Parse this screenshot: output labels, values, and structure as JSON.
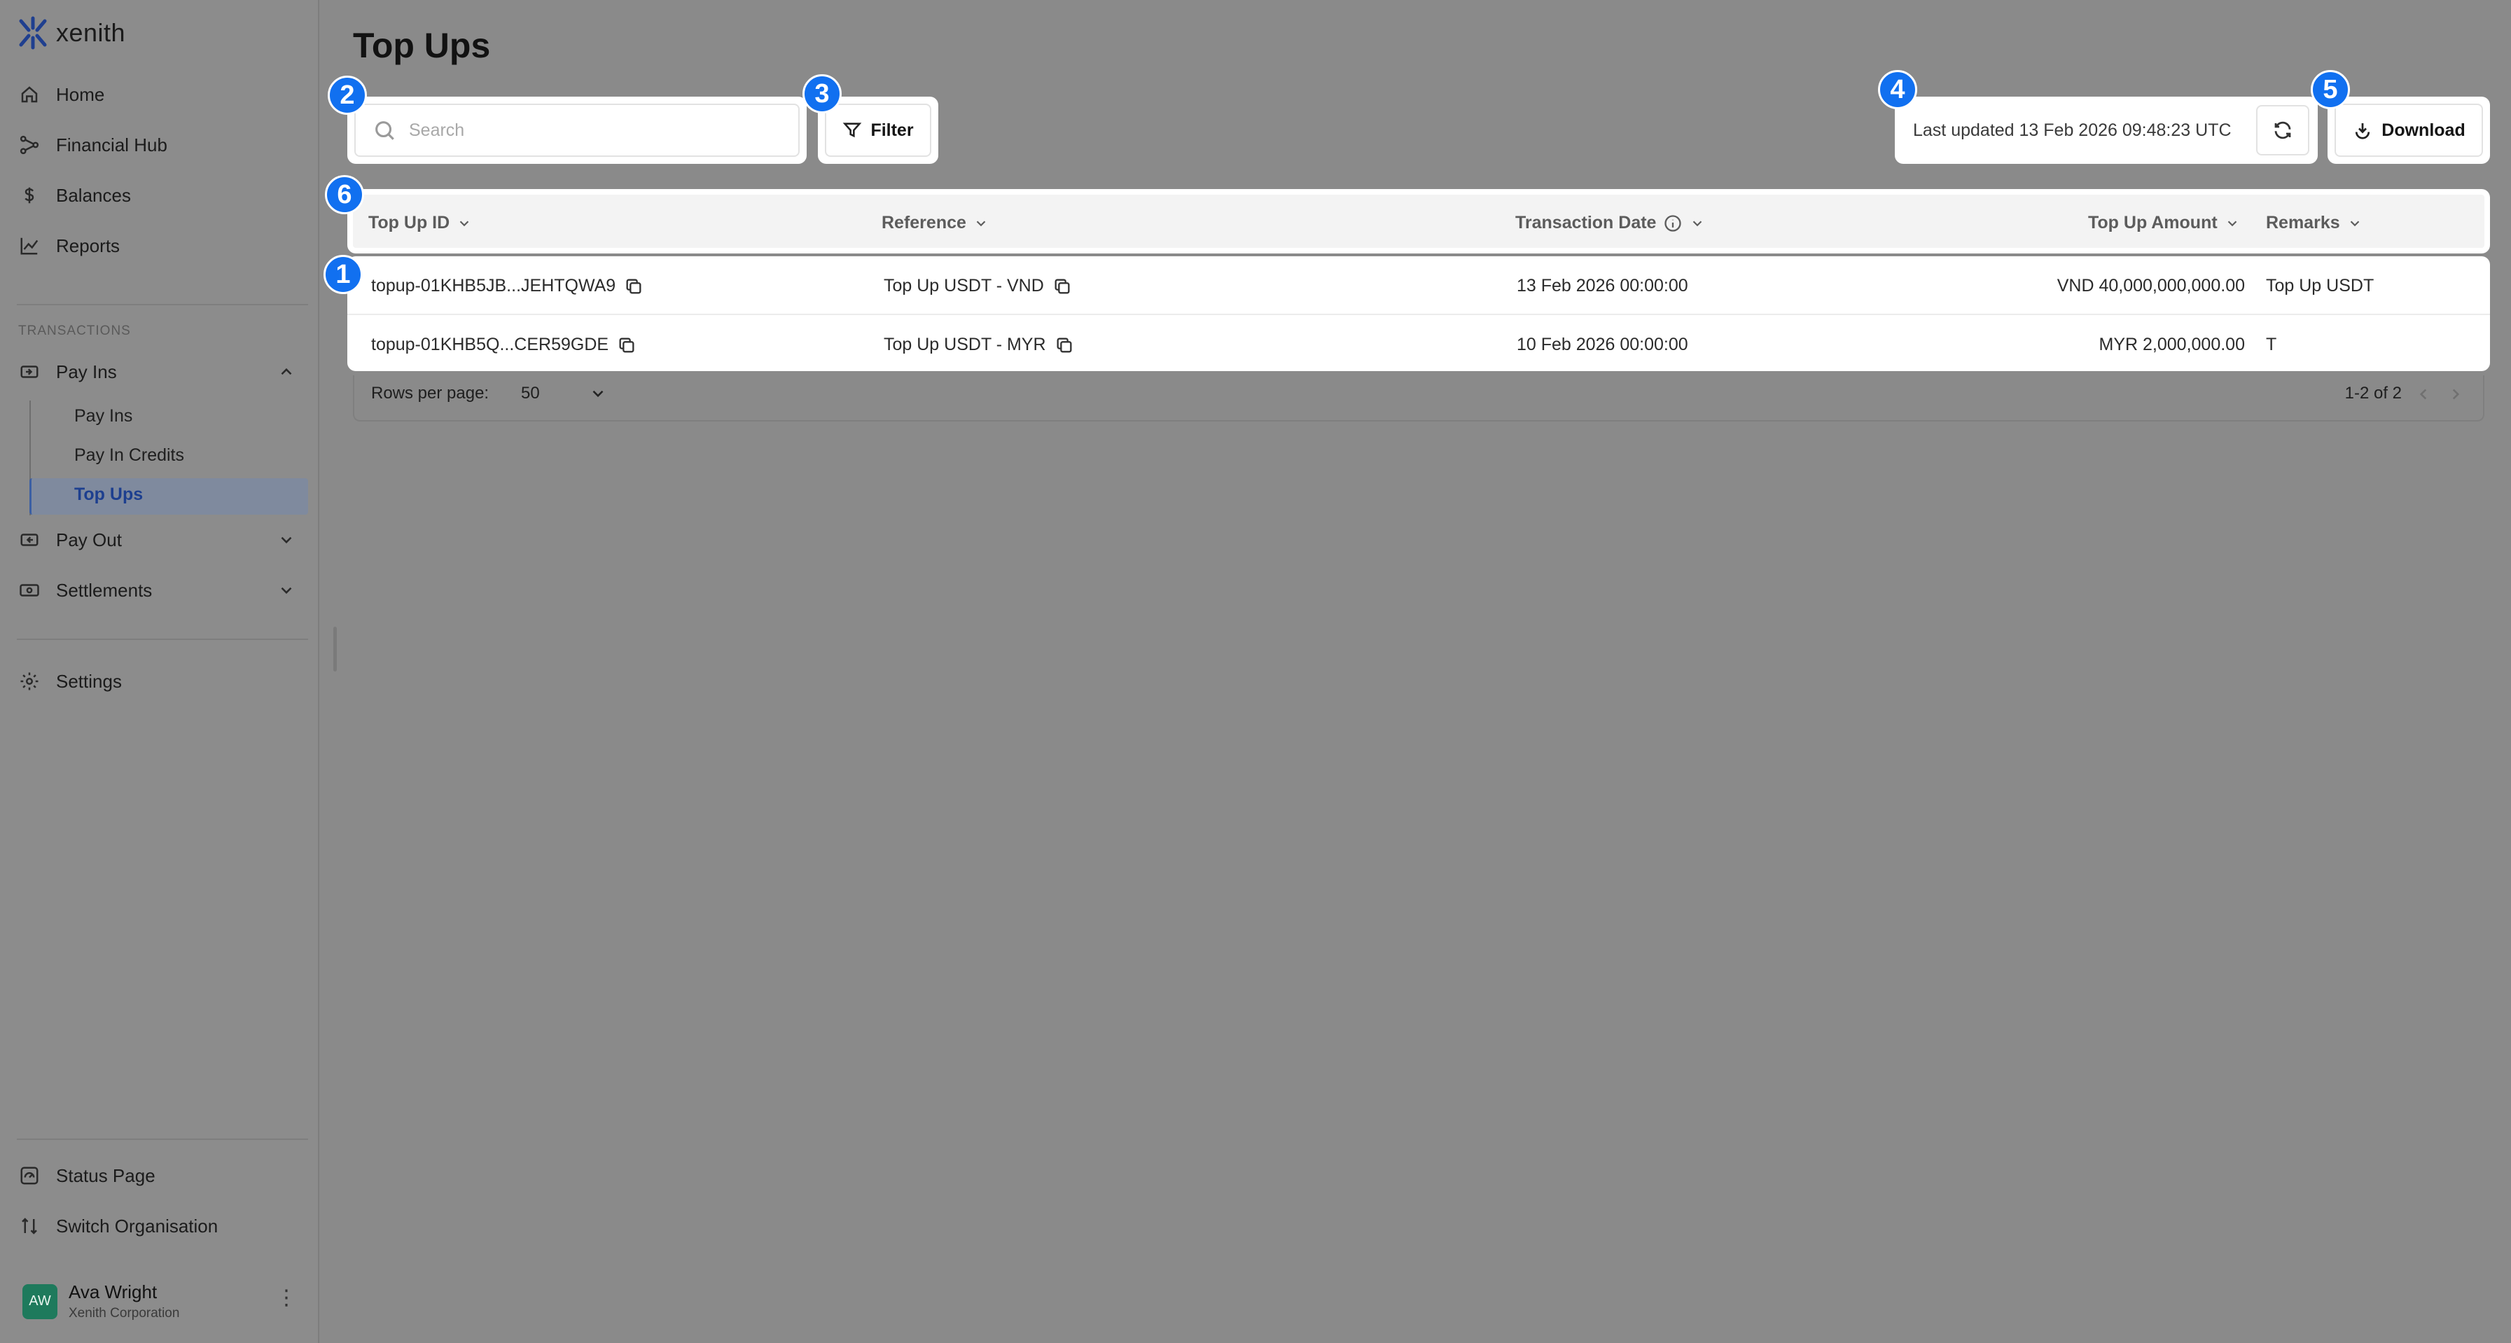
{
  "app": {
    "logo_text": "xenith"
  },
  "sidebar": {
    "nav": [
      {
        "label": "Home",
        "icon": "home-icon"
      },
      {
        "label": "Financial Hub",
        "icon": "hub-icon"
      },
      {
        "label": "Balances",
        "icon": "dollar-icon"
      },
      {
        "label": "Reports",
        "icon": "chart-icon"
      }
    ],
    "section_label": "TRANSACTIONS",
    "groups": [
      {
        "label": "Pay Ins",
        "expanded": true,
        "children": [
          "Pay Ins",
          "Pay In Credits",
          "Top Ups"
        ],
        "active_child": "Top Ups"
      },
      {
        "label": "Pay Out",
        "expanded": false
      },
      {
        "label": "Settlements",
        "expanded": false
      }
    ],
    "settings_label": "Settings",
    "status_label": "Status Page",
    "switch_label": "Switch Organisation",
    "user": {
      "initials": "AW",
      "name": "Ava Wright",
      "org": "Xenith Corporation"
    }
  },
  "page": {
    "title": "Top Ups"
  },
  "toolbar": {
    "search_placeholder": "Search",
    "filter_label": "Filter",
    "last_updated": "Last updated 13 Feb 2026 09:48:23 UTC",
    "download_label": "Download"
  },
  "table": {
    "columns": [
      "Top Up ID",
      "Reference",
      "Transaction Date",
      "Top Up Amount",
      "Remarks"
    ],
    "rows": [
      {
        "id": "topup-01KHB5JB...JEHTQWA9",
        "reference": "Top Up USDT - VND",
        "date": "13 Feb 2026 00:00:00",
        "amount": "VND 40,000,000,000.00",
        "remarks": "Top Up USDT"
      },
      {
        "id": "topup-01KHB5Q...CER59GDE",
        "reference": "Top Up USDT - MYR",
        "date": "10 Feb 2026 00:00:00",
        "amount": "MYR 2,000,000.00",
        "remarks": "T"
      }
    ]
  },
  "pagination": {
    "rows_per_page_label": "Rows per page:",
    "rows_per_page": "50",
    "range": "1-2 of 2"
  },
  "badges": [
    "1",
    "2",
    "3",
    "4",
    "5",
    "6"
  ],
  "colors": {
    "badge": "#1170f0",
    "active_nav": "#1d3f8f",
    "avatar": "#1e7a5c",
    "overlay": "#8a8a8a"
  }
}
